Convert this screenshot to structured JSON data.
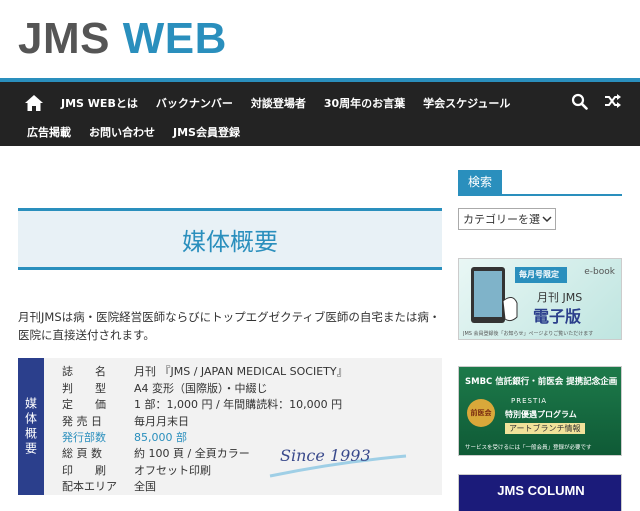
{
  "logo": {
    "part1": "JMS",
    "part2": "WEB"
  },
  "nav": {
    "row1": [
      "JMS WEBとは",
      "バックナンバー",
      "対談登場者",
      "30周年のお言葉",
      "学会スケジュール"
    ],
    "row2": [
      "広告掲載",
      "お問い合わせ",
      "JMS会員登録"
    ],
    "icons": [
      "home-icon",
      "search-icon",
      "shuffle-icon"
    ]
  },
  "main": {
    "title": "媒体概要",
    "intro": "月刊JMSは病・医院経営医師ならびにトップエグゼクティブ医師の自宅または病・医院に直接送付されます。",
    "media": {
      "side_label": "媒体概要",
      "rows": [
        {
          "k": "誌　　名",
          "v": "月刊 『JMS / JAPAN MEDICAL SOCIETY』"
        },
        {
          "k": "判　　型",
          "v": "A4 変形（国際版）・中綴じ"
        },
        {
          "k": "定　　価",
          "v": "1 部：1,000 円 / 年間購読料：10,000 円"
        },
        {
          "k": "発 売 日",
          "v": "毎月月末日"
        },
        {
          "k": "発行部数",
          "v": "85,000 部"
        },
        {
          "k": "総 頁 数",
          "v": "約 100 頁 / 全頁カラー"
        },
        {
          "k": "印　　刷",
          "v": "オフセット印刷"
        },
        {
          "k": "配本エリア",
          "v": "全国"
        }
      ],
      "since": "Since 1993"
    }
  },
  "sidebar": {
    "search_title": "検索",
    "category_placeholder": "カテゴリーを選",
    "banner1": {
      "badge": "毎月号限定",
      "ebook": "e-book",
      "title": "月刊 JMS",
      "subtitle": "電子版",
      "note": "JMS 会員登録後「お知らせ」ページよりご覧いただけます"
    },
    "banner2": {
      "top": "SMBC 信託銀行・前医会 提携記念企画",
      "brand": "PRESTIA",
      "program": "特別優遇プログラム",
      "art": "アートブランチ情報",
      "seal": "前医会",
      "sub": "サービスを受けるには「一般会員」登録が必要です"
    },
    "banner3": {
      "title": "JMS COLUMN"
    }
  },
  "colors": {
    "accent": "#2a8fbd",
    "nav_bg": "#232323",
    "side_label": "#2b3f8c"
  }
}
